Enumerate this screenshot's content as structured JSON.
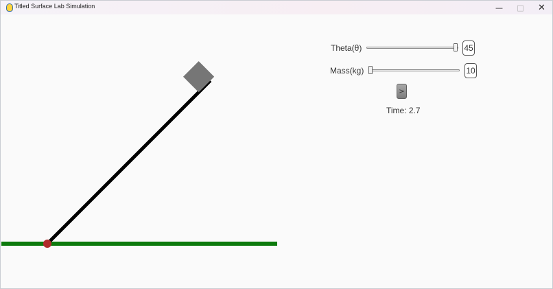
{
  "window": {
    "title": "Titled Surface Lab Simulation",
    "minimize_glyph": "—",
    "maximize_glyph": "□",
    "close_glyph": "✕"
  },
  "controls": {
    "theta": {
      "label": "Theta(θ)",
      "value": "45",
      "slider_fraction": 1.0
    },
    "mass": {
      "label": "Mass(kg)",
      "value": "10",
      "slider_fraction": 0.0
    },
    "play_button_label": ">",
    "time_label": "Time: 2.7"
  },
  "scene": {
    "incline_angle_deg": 45,
    "colors": {
      "ground": "#0c7a0c",
      "incline": "#000000",
      "pivot": "#b02a2a",
      "block": "#767676"
    }
  }
}
